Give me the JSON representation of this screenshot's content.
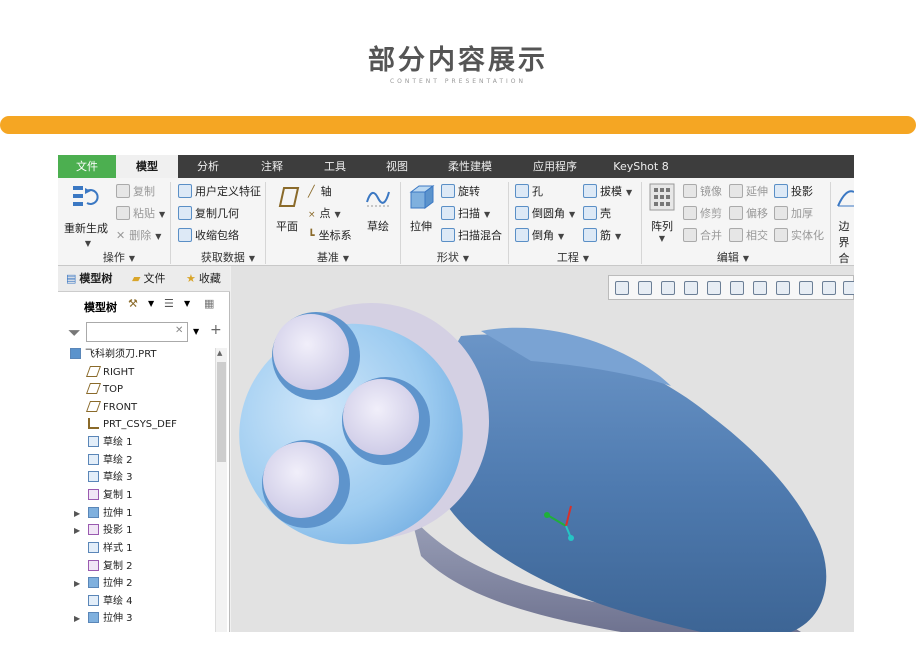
{
  "header": {
    "title": "部分内容展示",
    "subtitle": "CONTENT PRESENTATION"
  },
  "app": {
    "tabs": [
      "文件",
      "模型",
      "分析",
      "注释",
      "工具",
      "视图",
      "柔性建模",
      "应用程序",
      "KeyShot 8"
    ],
    "ribbon": {
      "groups": [
        "操作",
        "获取数据",
        "基准",
        "形状",
        "工程",
        "编辑"
      ],
      "operate": {
        "regen": "重新生成",
        "copy": "复制",
        "paste": "粘贴",
        "delete": "删除"
      },
      "getdata": {
        "udf": "用户定义特征",
        "copygeom": "复制几何",
        "shrinkwrap": "收缩包络"
      },
      "datum": {
        "plane": "平面",
        "axis": "轴",
        "point": "点",
        "csys": "坐标系",
        "sketch": "草绘"
      },
      "shape": {
        "extrude": "拉伸",
        "revolve": "旋转",
        "sweep": "扫描",
        "swept_blend": "扫描混合"
      },
      "engineering": {
        "hole": "孔",
        "round": "倒圆角",
        "chamfer": "倒角",
        "draft": "拔模",
        "shell": "壳",
        "rib": "筋"
      },
      "editing": {
        "pattern": "阵列",
        "mirror": "镜像",
        "trim": "修剪",
        "merge": "合并",
        "extend": "延伸",
        "offset": "偏移",
        "intersect": "相交",
        "project": "投影",
        "thicken": "加厚",
        "solidify": "实体化",
        "boundary": "边界",
        "boundary2": "合"
      }
    },
    "tree": {
      "tabs": [
        "模型树",
        "文件",
        "收藏"
      ],
      "toolbar_label": "模型树",
      "filter_placeholder": "",
      "nodes": [
        "飞科剃须刀.PRT",
        "RIGHT",
        "TOP",
        "FRONT",
        "PRT_CSYS_DEF",
        "草绘 1",
        "草绘 2",
        "草绘 3",
        "复制 1",
        "拉伸 1",
        "投影 1",
        "样式 1",
        "复制 2",
        "拉伸 2",
        "草绘 4",
        "拉伸 3"
      ]
    },
    "colors": {
      "file_tab": "#4caf50",
      "accent_bar": "#f5a623",
      "model_body": "#4f7bb0",
      "model_highlight": "#a8cff0"
    }
  }
}
